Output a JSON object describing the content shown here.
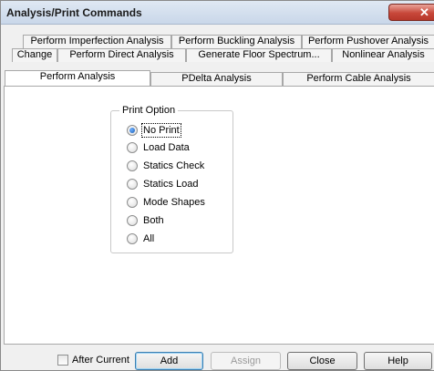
{
  "window": {
    "title": "Analysis/Print Commands",
    "close_glyph": "✕"
  },
  "tabs": {
    "row1": [
      "Perform Imperfection Analysis",
      "Perform Buckling Analysis",
      "Perform Pushover Analysis"
    ],
    "row2": [
      "Change",
      "Perform Direct Analysis",
      "Generate Floor Spectrum...",
      "Nonlinear Analysis"
    ],
    "row3": [
      "Perform Analysis",
      "PDelta Analysis",
      "Perform Cable Analysis"
    ],
    "active": "Perform Analysis"
  },
  "print_option": {
    "title": "Print Option",
    "options": [
      "No Print",
      "Load Data",
      "Statics Check",
      "Statics Load",
      "Mode Shapes",
      "Both",
      "All"
    ],
    "selected": "No Print"
  },
  "footer": {
    "after_current_label": "After Current",
    "after_current_checked": false,
    "add_label": "Add",
    "assign_label": "Assign",
    "close_label": "Close",
    "help_label": "Help"
  },
  "colors": {
    "accent": "#1a5fb4",
    "close_button": "#c8483a",
    "titlebar": "#c9d7e9"
  }
}
